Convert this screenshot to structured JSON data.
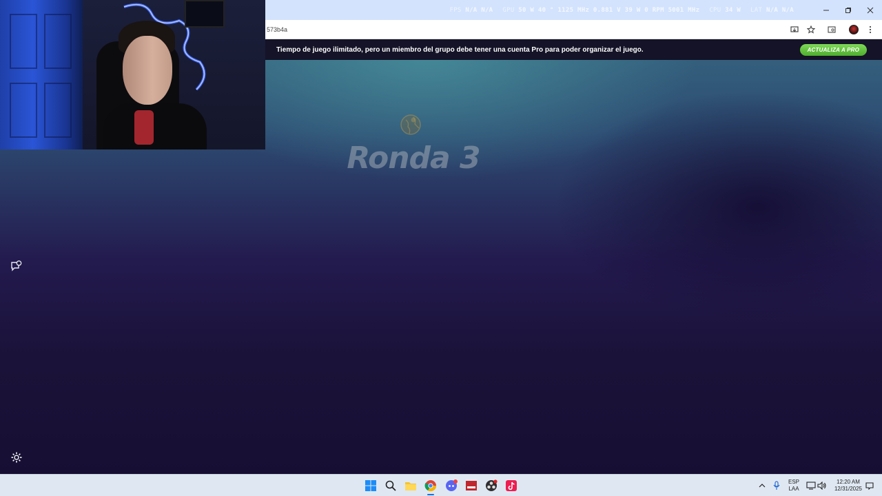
{
  "overlay_stats": {
    "fps_label": "FPS",
    "fps_value": "N/A",
    "fps_value2": "N/A",
    "gpu_label": "GPU",
    "gpu_values": "50 W  40 °  1125 MHz  0.881 V  39 W  0 RPM  5001 MHz",
    "cpu_label": "CPU",
    "cpu_value": "34 W",
    "lat_label": "LAT",
    "lat_value": "N/A",
    "lat_value2": "N/A"
  },
  "browser": {
    "url_fragment": "573b4a",
    "icons": [
      "install-icon",
      "star-icon",
      "extensions-icon",
      "profile-avatar",
      "more-icon"
    ]
  },
  "promo": {
    "message": "Tiempo de juego ilimitado, pero un miembro del grupo debe tener una cuenta Pro para poder organizar el juego.",
    "button_label": "ACTUALIZA A PRO"
  },
  "game": {
    "round_title": "Ronda 3"
  },
  "taskbar": {
    "apps": [
      "windows-start-icon",
      "search-icon",
      "file-explorer-icon",
      "chrome-icon",
      "discord-icon",
      "voice-app-icon",
      "obs-icon",
      "tiktok-icon"
    ],
    "tray": {
      "lang_line1": "ESP",
      "lang_line2": "LAA",
      "time": "12:20 AM",
      "date": "12/31/2025"
    }
  },
  "colors": {
    "promo_bg": "#141327",
    "promo_button": "#5fbf3a",
    "title_bar": "#d3e3fd",
    "taskbar": "#dfe8f2"
  }
}
